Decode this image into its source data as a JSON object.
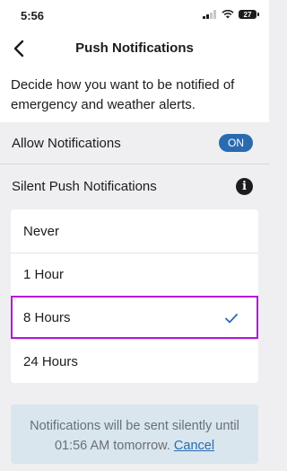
{
  "status_bar": {
    "time": "5:56",
    "battery": "27",
    "icons": [
      "signal-icon",
      "wifi-icon",
      "battery-icon"
    ]
  },
  "nav": {
    "title": "Push Notifications",
    "back_icon": "chevron-left-icon"
  },
  "description": "Decide how you want to be notified of emergency and weather alerts.",
  "allow_notifications": {
    "label": "Allow Notifications",
    "toggle_text": "ON",
    "enabled": true
  },
  "silent_push": {
    "label": "Silent Push Notifications",
    "info_icon": "info-icon",
    "info_glyph": "i"
  },
  "options": [
    {
      "label": "Never",
      "selected": false
    },
    {
      "label": "1 Hour",
      "selected": false
    },
    {
      "label": "8 Hours",
      "selected": true
    },
    {
      "label": "24 Hours",
      "selected": false
    }
  ],
  "notice": {
    "text": "Notifications will be sent silently until 01:56 AM tomorrow.",
    "cancel_label": "Cancel"
  },
  "colors": {
    "accent": "#2a6bb0",
    "selection_outline": "#b517d9",
    "background": "#efeff1",
    "notice_background": "#d9e6ee"
  }
}
